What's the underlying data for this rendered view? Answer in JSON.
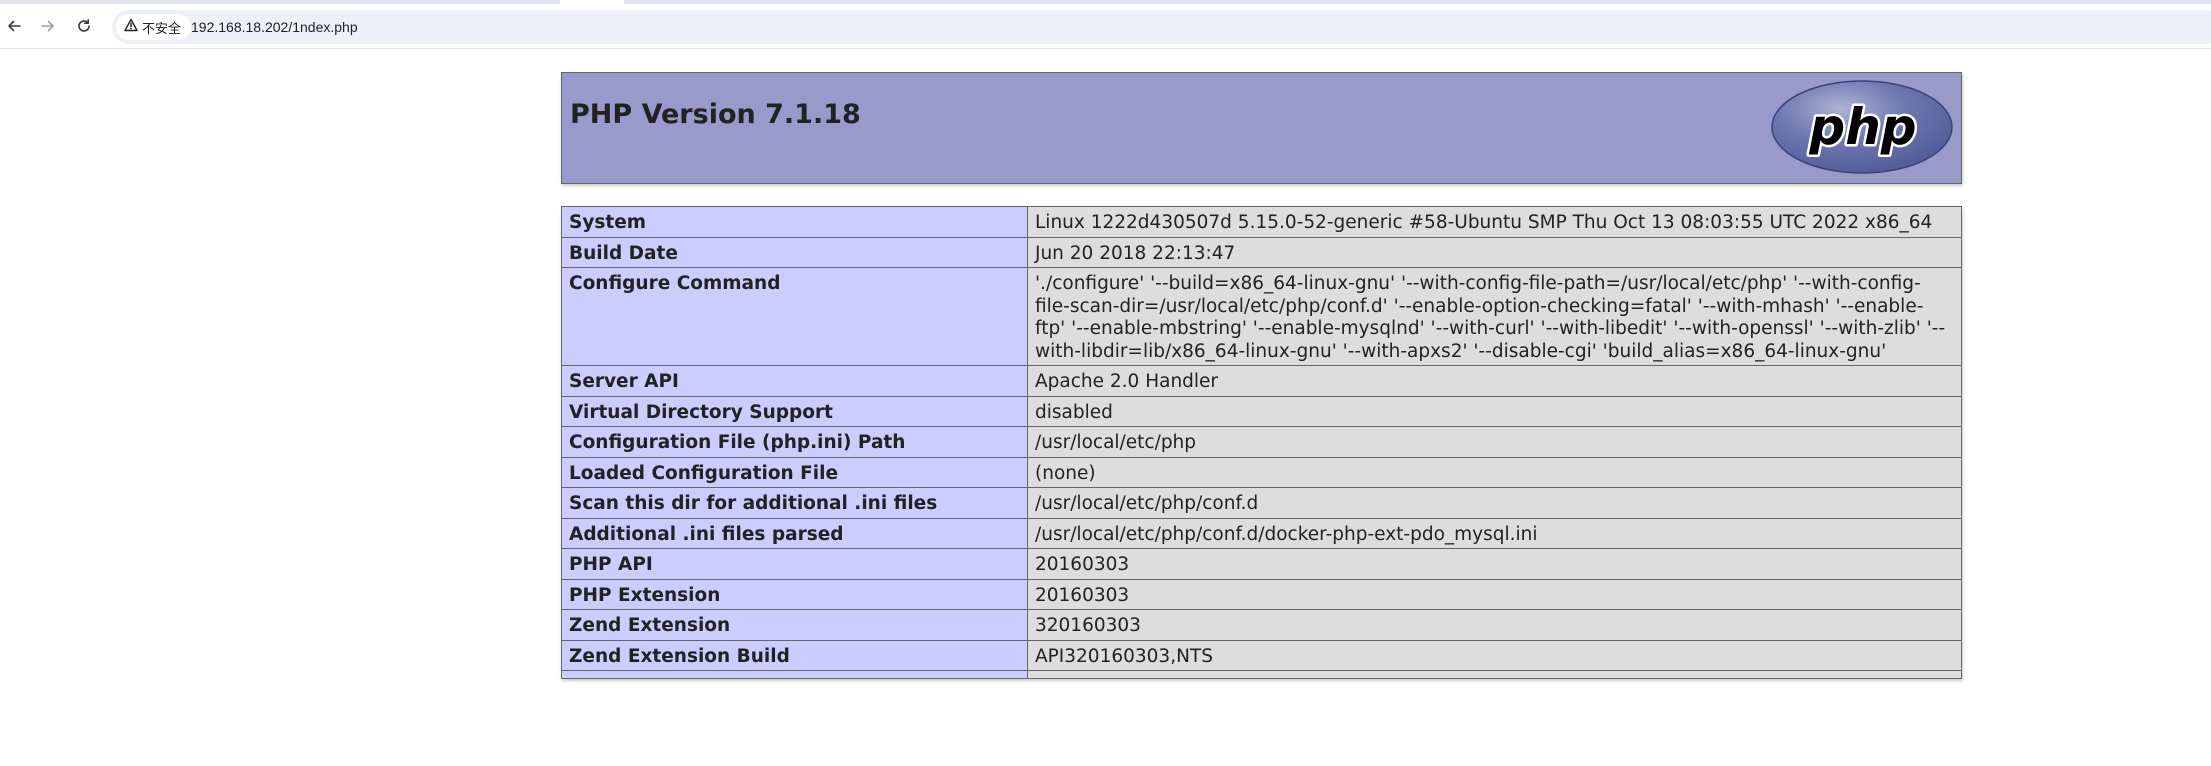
{
  "browser": {
    "security_label": "不安全",
    "url": "192.168.18.202/1ndex.php",
    "icons": [
      "back-arrow-icon",
      "forward-arrow-icon",
      "reload-icon",
      "warning-triangle-icon"
    ]
  },
  "page": {
    "title": "PHP Version 7.1.18",
    "logo_text": "php",
    "colors": {
      "header_bg": "#9999cc",
      "key_cell_bg": "#ccccff",
      "value_cell_bg": "#dddddd",
      "border": "#666666"
    }
  },
  "info_rows": [
    {
      "key": "System",
      "value": "Linux 1222d430507d 5.15.0-52-generic #58-Ubuntu SMP Thu Oct 13 08:03:55 UTC 2022 x86_64"
    },
    {
      "key": "Build Date",
      "value": "Jun 20 2018 22:13:47"
    },
    {
      "key": "Configure Command",
      "value": "'./configure' '--build=x86_64-linux-gnu' '--with-config-file-path=/usr/local/etc/php' '--with-config-file-scan-dir=/usr/local/etc/php/conf.d' '--enable-option-checking=fatal' '--with-mhash' '--enable-ftp' '--enable-mbstring' '--enable-mysqlnd' '--with-curl' '--with-libedit' '--with-openssl' '--with-zlib' '--with-libdir=lib/x86_64-linux-gnu' '--with-apxs2' '--disable-cgi' 'build_alias=x86_64-linux-gnu'"
    },
    {
      "key": "Server API",
      "value": "Apache 2.0 Handler"
    },
    {
      "key": "Virtual Directory Support",
      "value": "disabled"
    },
    {
      "key": "Configuration File (php.ini) Path",
      "value": "/usr/local/etc/php"
    },
    {
      "key": "Loaded Configuration File",
      "value": "(none)"
    },
    {
      "key": "Scan this dir for additional .ini files",
      "value": "/usr/local/etc/php/conf.d"
    },
    {
      "key": "Additional .ini files parsed",
      "value": "/usr/local/etc/php/conf.d/docker-php-ext-pdo_mysql.ini"
    },
    {
      "key": "PHP API",
      "value": "20160303"
    },
    {
      "key": "PHP Extension",
      "value": "20160303"
    },
    {
      "key": "Zend Extension",
      "value": "320160303"
    },
    {
      "key": "Zend Extension Build",
      "value": "API320160303,NTS"
    },
    {
      "key": "",
      "value": ""
    }
  ]
}
